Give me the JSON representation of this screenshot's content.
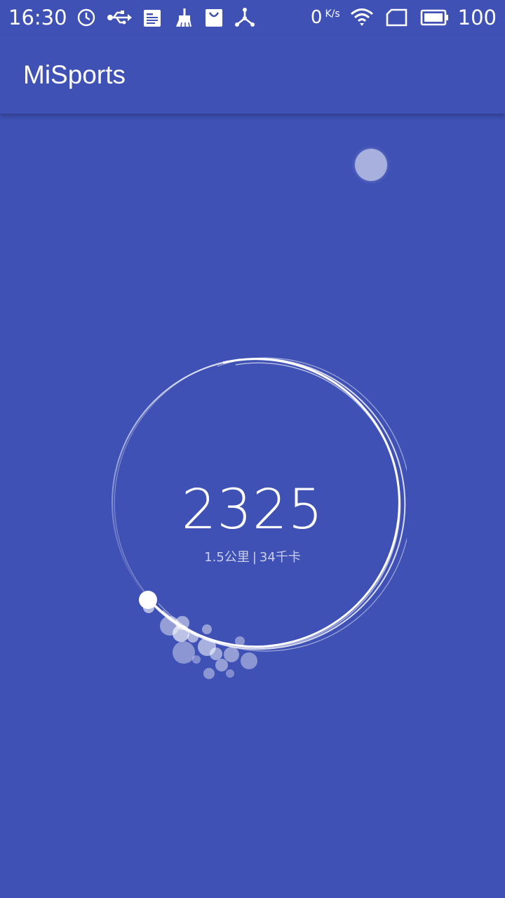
{
  "status_bar": {
    "time": "16:30",
    "left_icons": [
      "alarm-icon",
      "usb-icon",
      "notification-icon",
      "cleaner-icon",
      "shopping-bag-icon",
      "share-hub-icon"
    ],
    "net_speed_value": "0",
    "net_speed_unit": "K/s",
    "right_icons": [
      "wifi-icon",
      "sim-card-icon",
      "battery-icon"
    ],
    "battery_percent": "100"
  },
  "app_bar": {
    "title": "MiSports"
  },
  "steps": {
    "count": "2325",
    "distance": "1.5公里",
    "separator": "|",
    "calories": "34千卡",
    "progress": 0.82
  },
  "colors": {
    "background": "#3f51b5",
    "ring": "#ffffff"
  }
}
